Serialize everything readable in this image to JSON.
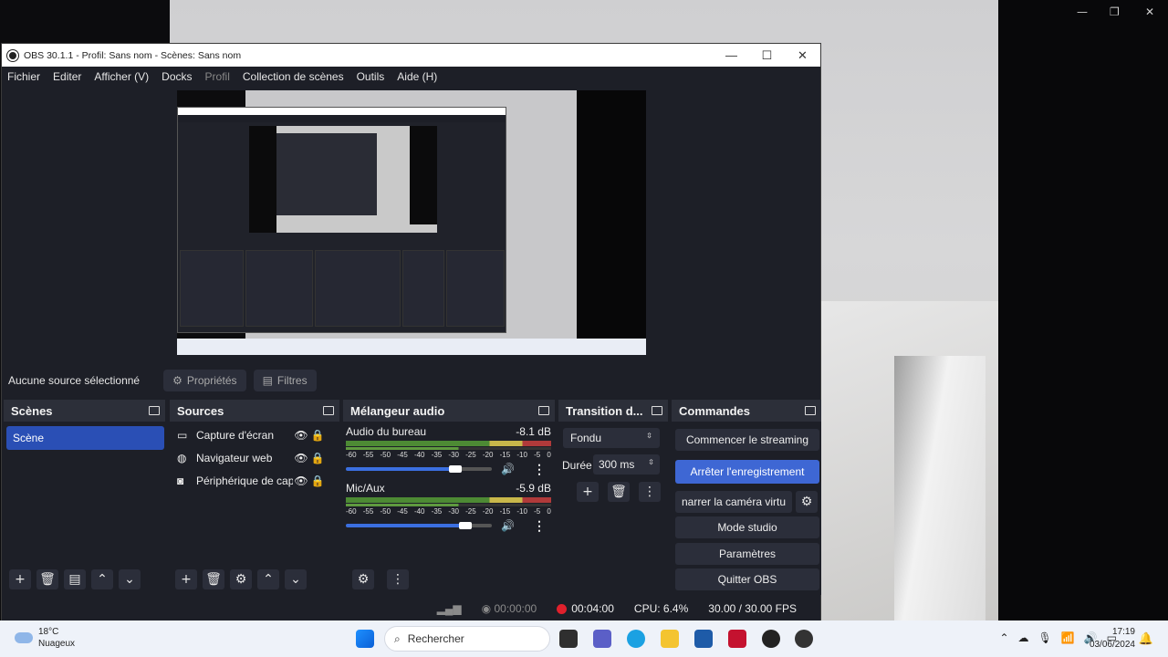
{
  "window": {
    "title": "OBS 30.1.1 - Profil: Sans nom - Scènes: Sans nom"
  },
  "menu": [
    "Fichier",
    "Editer",
    "Afficher (V)",
    "Docks",
    "Profil",
    "Collection de scènes",
    "Outils",
    "Aide (H)"
  ],
  "preview_bar": {
    "label": "Aucune source sélectionné",
    "properties": "Propriétés",
    "filters": "Filtres"
  },
  "scenes": {
    "title": "Scènes",
    "items": [
      "Scène"
    ]
  },
  "sources": {
    "title": "Sources",
    "items": [
      "Capture d'écran",
      "Navigateur web",
      "Périphérique de cap"
    ]
  },
  "mixer": {
    "title": "Mélangeur audio",
    "scale": [
      "-60",
      "-55",
      "-50",
      "-45",
      "-40",
      "-35",
      "-30",
      "-25",
      "-20",
      "-15",
      "-10",
      "-5",
      "0"
    ],
    "channels": [
      {
        "name": "Audio du bureau",
        "db": "-8.1 dB",
        "level": 0.75
      },
      {
        "name": "Mic/Aux",
        "db": "-5.9 dB",
        "level": 0.82
      }
    ]
  },
  "transitions": {
    "title": "Transition d...",
    "type": "Fondu",
    "duration_label": "Durée",
    "duration": "300 ms"
  },
  "controls": {
    "title": "Commandes",
    "start_streaming": "Commencer le streaming",
    "stop_recording": "Arrêter l'enregistrement",
    "virtual_cam": "narrer la caméra virtu",
    "studio_mode": "Mode studio",
    "settings": "Paramètres",
    "exit": "Quitter OBS"
  },
  "status": {
    "stream_time": "00:00:00",
    "rec_time": "00:04:00",
    "cpu": "CPU: 6.4%",
    "fps": "30.00 / 30.00 FPS"
  },
  "taskbar": {
    "temp": "18°C",
    "weather": "Nuageux",
    "search": "Rechercher",
    "time": "17:19",
    "date": "03/06/2024"
  }
}
